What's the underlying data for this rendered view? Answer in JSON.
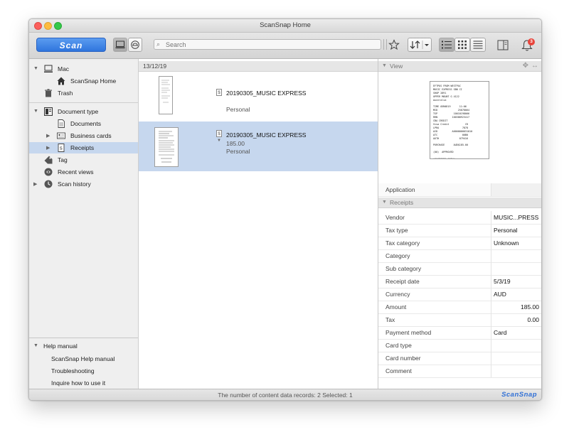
{
  "window": {
    "title": "ScanSnap Home"
  },
  "toolbar": {
    "scan_label": "Scan",
    "search_placeholder": "Search",
    "notification_count": "3"
  },
  "sidebar": {
    "mac": "Mac",
    "scansnap_home": "ScanSnap Home",
    "trash": "Trash",
    "document_type": "Document type",
    "documents": "Documents",
    "business_cards": "Business cards",
    "receipts": "Receipts",
    "tag": "Tag",
    "recent_views": "Recent views",
    "scan_history": "Scan history",
    "help_manual": "Help manual",
    "help_items": [
      "ScanSnap Help manual",
      "Troubleshooting",
      "Inquire how to use it"
    ]
  },
  "list": {
    "date": "13/12/19",
    "items": [
      {
        "title": "20190305_MUSIC EXPRESS",
        "amount": "",
        "category": "Personal"
      },
      {
        "title": "20190305_MUSIC EXPRESS",
        "amount": "185.00",
        "category": "Personal"
      }
    ]
  },
  "view": {
    "header": "View",
    "receipt_lines": [
      "EFTPOS FROM WESTPAC",
      "MUSIC EXPRESS SBN CI",
      "SHOP 2891",
      "UPPER MOUNT G 4122",
      "Australia",
      "",
      "TIME 05MAR19      11:06",
      "MID              25878064",
      "TSP           10010198066",
      "RRN          100388923417",
      "CBA CREDIT",
      "Visa Credit           CR",
      "LPRA                7878",
      "AID          A0000000031010",
      "ATC                 00B0",
      "AUTH              079416",
      "",
      "PURCHASE      AUD$185.00",
      "",
      "(00)  APPROVED",
      "",
      "*CUSTOMER COPY*"
    ],
    "application_label": "Application",
    "application_value": ""
  },
  "receipts_panel": {
    "header": "Receipts",
    "fields": [
      {
        "key": "Vendor",
        "value": "MUSIC...PRESS"
      },
      {
        "key": "Tax type",
        "value": "Personal"
      },
      {
        "key": "Tax category",
        "value": "Unknown"
      },
      {
        "key": "Category",
        "value": ""
      },
      {
        "key": "Sub category",
        "value": ""
      },
      {
        "key": "Receipt date",
        "value": "5/3/19"
      },
      {
        "key": "Currency",
        "value": "AUD"
      },
      {
        "key": "Amount",
        "value": "185.00"
      },
      {
        "key": "Tax",
        "value": "0.00"
      },
      {
        "key": "Payment method",
        "value": "Card"
      },
      {
        "key": "Card type",
        "value": ""
      },
      {
        "key": "Card number",
        "value": ""
      },
      {
        "key": "Comment",
        "value": ""
      }
    ]
  },
  "status": {
    "text": "The number of content data records: 2  Selected: 1",
    "brand": "ScanSnap"
  },
  "colors": {
    "accent": "#3a82e4",
    "selection": "#c6d7ee",
    "badge": "#e8453c"
  },
  "icons": [
    "computer-icon",
    "house-icon",
    "trash-icon",
    "document-type-icon",
    "document-icon",
    "business-card-icon",
    "receipt-icon",
    "tag-icon",
    "recent-views-icon",
    "scan-history-icon",
    "star-icon",
    "sort-icon",
    "list-view-icon",
    "grid-view-icon",
    "detail-view-icon",
    "panel-icon",
    "bell-icon",
    "search-icon"
  ]
}
